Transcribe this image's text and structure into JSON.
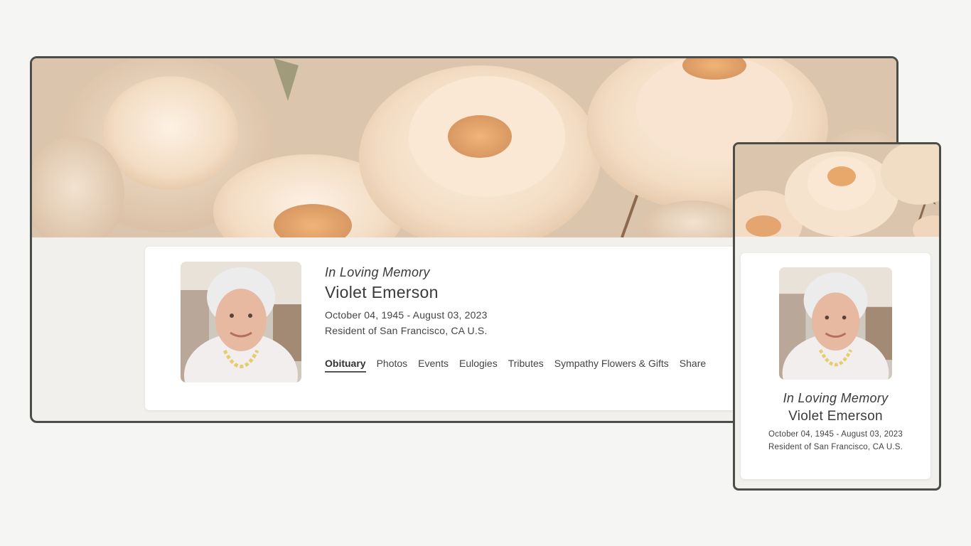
{
  "desktop": {
    "memorial": {
      "memory_label": "In Loving Memory",
      "name": "Violet Emerson",
      "dates": "October 04, 1945 - August 03, 2023",
      "residence": "Resident of San Francisco, CA U.S."
    },
    "nav": {
      "tabs": [
        {
          "label": "Obituary",
          "active": true
        },
        {
          "label": "Photos"
        },
        {
          "label": "Events"
        },
        {
          "label": "Eulogies"
        },
        {
          "label": "Tributes"
        },
        {
          "label": "Sympathy Flowers & Gifts"
        },
        {
          "label": "Share"
        }
      ]
    }
  },
  "mobile": {
    "memorial": {
      "memory_label": "In Loving Memory",
      "name": "Violet Emerson",
      "dates": "October 04, 1945 - August 03, 2023",
      "residence": "Resident of San Francisco, CA U.S."
    }
  },
  "colors": {
    "frame_border": "#4a4d48",
    "page_background": "#f5f5f4",
    "panel_background": "#f1f0ec",
    "peony_petal": "#f6e3cd",
    "peony_center": "#e8a76b"
  }
}
